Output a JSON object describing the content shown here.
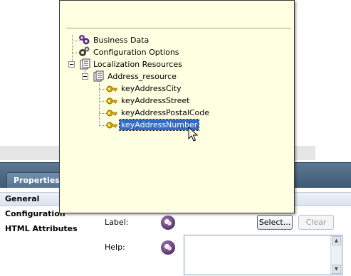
{
  "popup": {
    "tree": [
      {
        "label": "Business Data",
        "icon": "business-data-icon"
      },
      {
        "label": "Configuration Options",
        "icon": "gears-icon"
      },
      {
        "label": "Localization Resources",
        "icon": "resource-stack-icon",
        "expanded": true
      },
      {
        "label": "Address_resource",
        "icon": "resource-stack-icon",
        "expanded": true
      },
      {
        "label": "keyAddressCity",
        "icon": "key-icon"
      },
      {
        "label": "keyAddressStreet",
        "icon": "key-icon"
      },
      {
        "label": "keyAddressPostalCode",
        "icon": "key-icon"
      },
      {
        "label": "keyAddressNumber",
        "icon": "key-icon",
        "selected": true
      }
    ]
  },
  "properties": {
    "tab_label": "Properties",
    "sidebar": [
      "General",
      "Configuration",
      "HTML Attributes"
    ],
    "label_field_label": "Label:",
    "help_field_label": "Help:",
    "select_button": "Select...",
    "clear_button": "Clear",
    "help_value": ""
  },
  "colors": {
    "popup_bg": "#ffffe1",
    "selection": "#316ac5",
    "header": "#4a6782"
  }
}
